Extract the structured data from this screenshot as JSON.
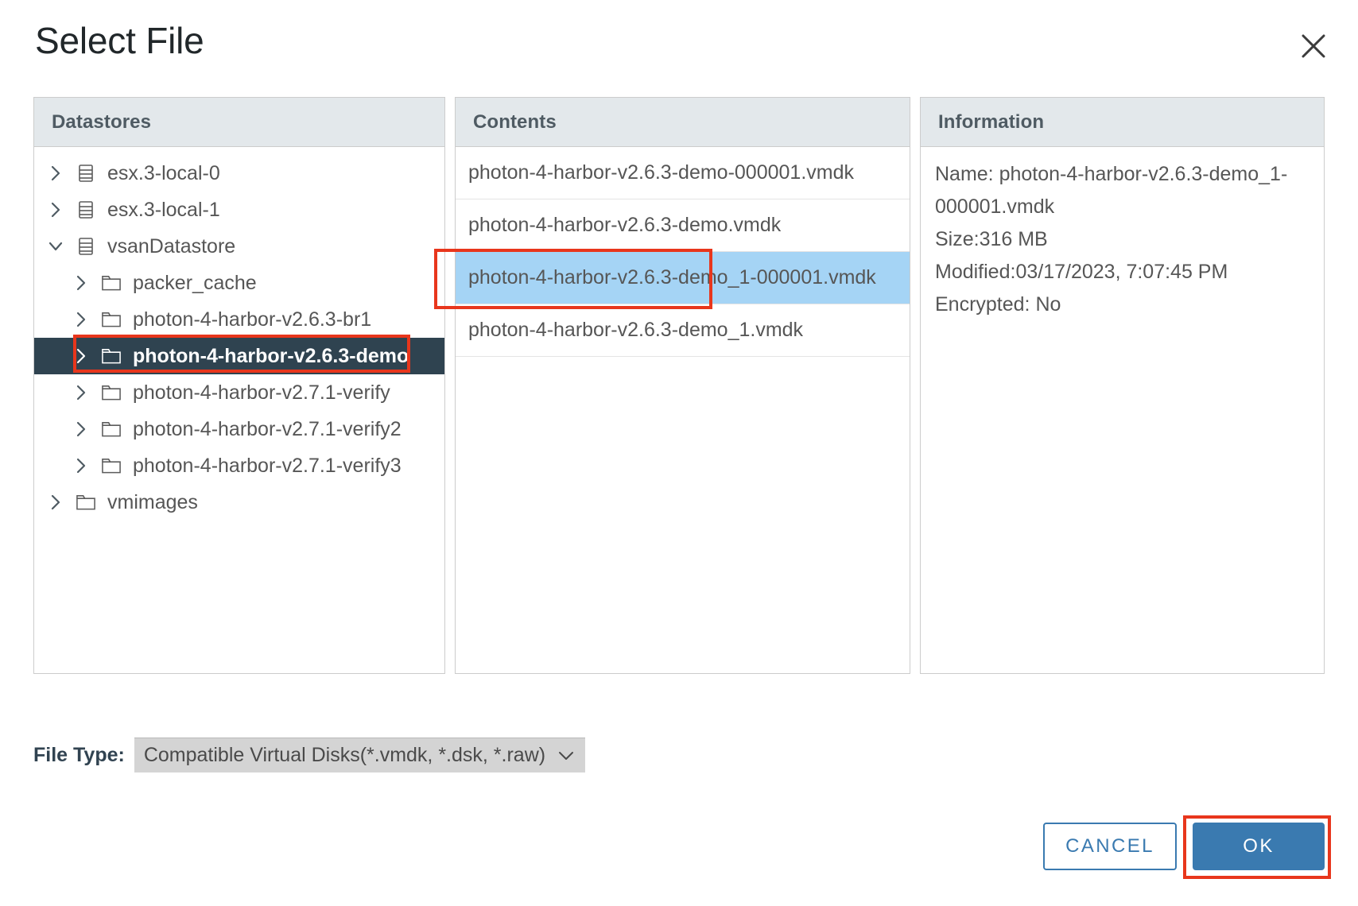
{
  "dialog": {
    "title": "Select File",
    "close_icon": "close-icon"
  },
  "panels": {
    "datastores": {
      "header": "Datastores",
      "tree": [
        {
          "label": "esx.3-local-0",
          "icon": "datastore-icon",
          "level": 0,
          "expanded": false,
          "selected": false
        },
        {
          "label": "esx.3-local-1",
          "icon": "datastore-icon",
          "level": 0,
          "expanded": false,
          "selected": false
        },
        {
          "label": "vsanDatastore",
          "icon": "datastore-icon",
          "level": 0,
          "expanded": true,
          "selected": false
        },
        {
          "label": "packer_cache",
          "icon": "folder-icon",
          "level": 1,
          "expanded": false,
          "selected": false
        },
        {
          "label": "photon-4-harbor-v2.6.3-br1",
          "icon": "folder-icon",
          "level": 1,
          "expanded": false,
          "selected": false
        },
        {
          "label": "photon-4-harbor-v2.6.3-demo",
          "icon": "folder-icon",
          "level": 1,
          "expanded": false,
          "selected": true
        },
        {
          "label": "photon-4-harbor-v2.7.1-verify",
          "icon": "folder-icon",
          "level": 1,
          "expanded": false,
          "selected": false
        },
        {
          "label": "photon-4-harbor-v2.7.1-verify2",
          "icon": "folder-icon",
          "level": 1,
          "expanded": false,
          "selected": false
        },
        {
          "label": "photon-4-harbor-v2.7.1-verify3",
          "icon": "folder-icon",
          "level": 1,
          "expanded": false,
          "selected": false
        },
        {
          "label": "vmimages",
          "icon": "folder-icon",
          "level": 0,
          "expanded": false,
          "selected": false
        }
      ]
    },
    "contents": {
      "header": "Contents",
      "files": [
        {
          "name": "photon-4-harbor-v2.6.3-demo-000001.vmdk",
          "selected": false
        },
        {
          "name": "photon-4-harbor-v2.6.3-demo.vmdk",
          "selected": false
        },
        {
          "name": "photon-4-harbor-v2.6.3-demo_1-000001.vmdk",
          "selected": true
        },
        {
          "name": "photon-4-harbor-v2.6.3-demo_1.vmdk",
          "selected": false
        }
      ]
    },
    "information": {
      "header": "Information",
      "lines": [
        "Name: photon-4-harbor-v2.6.3-demo_1-000001.vmdk",
        "Size:316 MB",
        "Modified:03/17/2023, 7:07:45 PM",
        "Encrypted: No"
      ]
    }
  },
  "filetype": {
    "label": "File Type:",
    "value": "Compatible Virtual Disks(*.vmdk, *.dsk, *.raw)",
    "chevron_icon": "chevron-down-icon"
  },
  "footer": {
    "cancel_label": "CANCEL",
    "ok_label": "OK"
  },
  "colors": {
    "accent": "#3a7ab0",
    "highlight_box": "#e8361c",
    "row_selected_tree": "#2f4350",
    "row_selected_contents": "#a5d4f5",
    "panel_header_bg": "#e3e8eb"
  }
}
